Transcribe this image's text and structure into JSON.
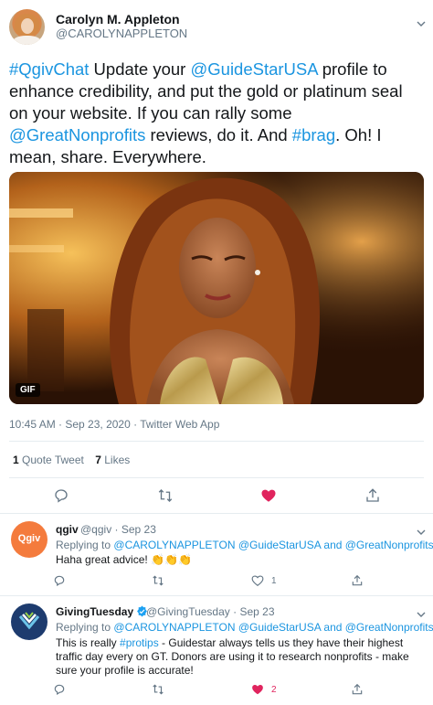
{
  "tweet": {
    "author_name": "Carolyn M. Appleton",
    "author_handle": "@CAROLYNAPPLETON",
    "text_parts": [
      {
        "t": "#QgivChat",
        "link": true
      },
      {
        "t": " Update your ",
        "link": false
      },
      {
        "t": "@GuideStarUSA",
        "link": true
      },
      {
        "t": " profile to enhance credibility, and put the gold or platinum seal on your website. If you can rally some ",
        "link": false
      },
      {
        "t": "@GreatNonprofits",
        "link": true
      },
      {
        "t": " reviews, do it. And ",
        "link": false
      },
      {
        "t": "#brag",
        "link": true
      },
      {
        "t": ". Oh! I mean, share. Everywhere.",
        "link": false
      }
    ],
    "media_badge": "GIF",
    "timestamp": "10:45 AM · Sep 23, 2020 · Twitter Web App",
    "quote_count": "1",
    "quote_label": "Quote Tweet",
    "like_count": "7",
    "like_label": "Likes",
    "accent": "#1b95e0",
    "like_color": "#e0245e"
  },
  "replies": [
    {
      "name": "qgiv",
      "handle": "@qgiv",
      "date": "Sep 23",
      "avatar_text": "Qgiv",
      "avatar_color": "#f47b3d",
      "replying_label": "Replying to",
      "replying_to": "@CAROLYNAPPLETON @GuideStarUSA and @GreatNonprofits",
      "lines": [
        "Haha great advice! 👏👏👏"
      ],
      "like_count": "1",
      "liked": false
    },
    {
      "name": "GivingTuesday",
      "handle": "@GivingTuesday",
      "date": "Sep 23",
      "verified": true,
      "replying_label": "Replying to",
      "replying_to": "@CAROLYNAPPLETON @GuideStarUSA and @GreatNonprofits",
      "lines_parts": [
        [
          {
            "t": "This is really ",
            "link": false
          },
          {
            "t": "#protips",
            "link": true
          },
          {
            "t": " - Guidestar always tells us they have their highest",
            "link": false
          }
        ],
        [
          {
            "t": "traffic day every on GT. Donors are using it to research nonprofits - make",
            "link": false
          }
        ],
        [
          {
            "t": "sure your profile is accurate!",
            "link": false
          }
        ]
      ],
      "like_count": "2",
      "liked": true
    }
  ]
}
